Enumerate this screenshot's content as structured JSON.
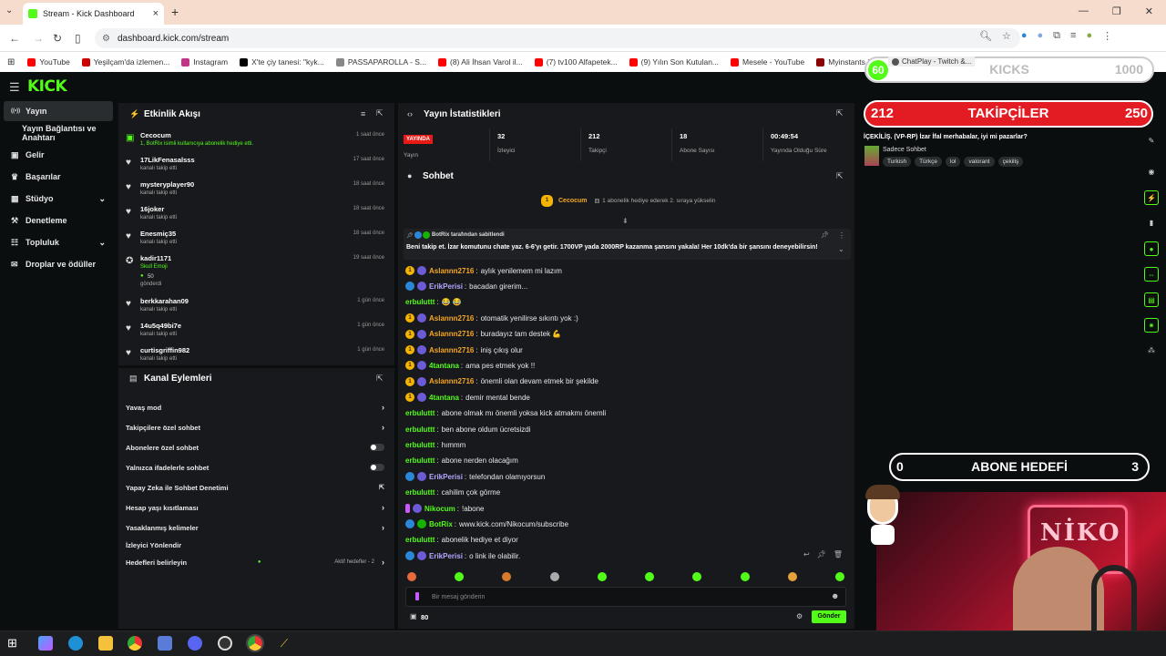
{
  "browser": {
    "tab_title": "Stream - Kick Dashboard",
    "url": "dashboard.kick.com/stream",
    "bookmarks": [
      {
        "label": "YouTube",
        "color": "#ff0000"
      },
      {
        "label": "Yeşilçam'da izlemen...",
        "color": "#cc0000"
      },
      {
        "label": "Instagram",
        "color": "#c13584"
      },
      {
        "label": "X'te çiy tanesi: \"kyk...",
        "color": "#000000"
      },
      {
        "label": "PASSAPAROLLA - S...",
        "color": "#888888"
      },
      {
        "label": "(8) Ali İhsan Varol il...",
        "color": "#ff0000"
      },
      {
        "label": "(7) tv100 Alfapetek...",
        "color": "#ff0000"
      },
      {
        "label": "(9) Yılın Son Kutulan...",
        "color": "#ff0000"
      },
      {
        "label": "Mesele - YouTube",
        "color": "#ff0000"
      },
      {
        "label": "Myinstants | The la...",
        "color": "#8b0000"
      },
      {
        "label": "ChatPlay - Twitch &...",
        "color": "#555555"
      }
    ]
  },
  "kick": {
    "logo": "KICK",
    "brand_color": "#53fc18",
    "sidebar": [
      {
        "label": "Yayın",
        "icon": "broadcast-icon",
        "active": true
      },
      {
        "label": "Yayın Bağlantısı ve Anahtarı",
        "icon": "",
        "active": false
      },
      {
        "label": "Gelir",
        "icon": "wallet-icon",
        "active": false
      },
      {
        "label": "Başarılar",
        "icon": "trophy-icon",
        "active": false
      },
      {
        "label": "Stüdyo",
        "icon": "studio-icon",
        "active": false,
        "chevron": true
      },
      {
        "label": "Denetleme",
        "icon": "hammer-icon",
        "active": false
      },
      {
        "label": "Topluluk",
        "icon": "community-icon",
        "active": false,
        "chevron": true
      },
      {
        "label": "Droplar ve ödüller",
        "icon": "gift-icon",
        "active": false
      }
    ],
    "activity": {
      "title": "Etkinlik Akışı",
      "items": [
        {
          "name": "Cecocum",
          "sub": "1, BotRix isimli kullanıcıya abonelik hediye etti.",
          "time": "1 saat önce",
          "type": "gift"
        },
        {
          "name": "17LikFenasalsss",
          "sub": "kanalı takip etti",
          "time": "17 saat önce",
          "type": "follow"
        },
        {
          "name": "mysteryplayer90",
          "sub": "kanalı takip etti",
          "time": "18 saat önce",
          "type": "follow"
        },
        {
          "name": "16joker",
          "sub": "kanalı takip etti",
          "time": "18 saat önce",
          "type": "follow"
        },
        {
          "name": "Enesmiç35",
          "sub": "kanalı takip etti",
          "time": "18 saat önce",
          "type": "follow"
        },
        {
          "name": "kadir1171",
          "sub": "Skull Emoji",
          "sub2": "50",
          "sub3": "gönderdi",
          "time": "19 saat önce",
          "type": "kicks"
        },
        {
          "name": "berkkarahan09",
          "sub": "kanalı takip etti",
          "time": "1 gün önce",
          "type": "follow"
        },
        {
          "name": "14u5q49bi7e",
          "sub": "kanalı takip etti",
          "time": "1 gün önce",
          "type": "follow"
        },
        {
          "name": "curtisgriffin982",
          "sub": "kanalı takip etti",
          "time": "1 gün önce",
          "type": "follow"
        }
      ]
    },
    "channel_actions": {
      "title": "Kanal Eylemleri",
      "items": [
        {
          "label": "Yavaş mod",
          "control": "chevron"
        },
        {
          "label": "Takipçilere özel sohbet",
          "control": "chevron"
        },
        {
          "label": "Abonelere özel sohbet",
          "control": "toggle"
        },
        {
          "label": "Yalnızca ifadelerle sohbet",
          "control": "toggle"
        },
        {
          "label": "Yapay Zeka ile Sohbet Denetimi",
          "control": "external"
        },
        {
          "label": "Hesap yaşı kısıtlaması",
          "control": "chevron"
        },
        {
          "label": "Yasaklanmış kelimeler",
          "control": "chevron"
        },
        {
          "label": "İzleyici Yönlendir",
          "control": "none"
        },
        {
          "label": "Hedefleri belirleyin",
          "control": "chevron",
          "note": "Aktif hedefler - 2"
        }
      ]
    },
    "stats": {
      "title": "Yayın İstatistikleri",
      "live_badge": "YAYINDA",
      "live_label": "Yayın",
      "items": [
        {
          "value": "32",
          "label": "İzleyici"
        },
        {
          "value": "212",
          "label": "Takipçi"
        },
        {
          "value": "18",
          "label": "Abone Sayısı"
        },
        {
          "value": "00:49:54",
          "label": "Yayında Olduğu Süre"
        }
      ]
    },
    "chat": {
      "title": "Sohbet",
      "gift_banner": {
        "name": "Cecocum",
        "count": "1",
        "text": "1 abonelik hediye ederek 2. sıraya yükselin"
      },
      "pinned_by": "BotRix tarafından sabitlendi",
      "pinned_text": "Beni takip et. İzar komutunu chate yaz. 6-6'yı getir. 1700VP yada 2000RP kazanma şansını yakala! Her 10dk'da bir şansını deneyebilirsin!",
      "messages": [
        {
          "user": "Aslannn2716",
          "color": "#f5a623",
          "badges": [
            "gold",
            "purp"
          ],
          "text": "aylık yenilemem mi lazım"
        },
        {
          "user": "ErikPerisi",
          "color": "#b2a9ff",
          "badges": [
            "blue",
            "purp"
          ],
          "text": "bacadan girerim..."
        },
        {
          "user": "erbuluttt",
          "color": "#53fc18",
          "badges": [],
          "text": "😂 😂"
        },
        {
          "user": "Aslannn2716",
          "color": "#f5a623",
          "badges": [
            "gold",
            "purp"
          ],
          "text": "otomatik yenilirse sıkıntı yok :)"
        },
        {
          "user": "Aslannn2716",
          "color": "#f5a623",
          "badges": [
            "gold",
            "purp"
          ],
          "text": "buradayız tam destek 💪"
        },
        {
          "user": "Aslannn2716",
          "color": "#f5a623",
          "badges": [
            "gold",
            "purp"
          ],
          "text": "iniş çıkış olur"
        },
        {
          "user": "4tantana",
          "color": "#53fc18",
          "badges": [
            "gold",
            "purp"
          ],
          "text": "ama pes etmek yok !!"
        },
        {
          "user": "Aslannn2716",
          "color": "#f5a623",
          "badges": [
            "gold",
            "purp"
          ],
          "text": "önemli olan devam etmek bir şekilde"
        },
        {
          "user": "4tantana",
          "color": "#53fc18",
          "badges": [
            "gold",
            "purp"
          ],
          "text": "demir mental bende"
        },
        {
          "user": "erbuluttt",
          "color": "#53fc18",
          "badges": [],
          "text": "abone olmak mı önemli yoksa kick atmakmı önemli"
        },
        {
          "user": "erbuluttt",
          "color": "#53fc18",
          "badges": [],
          "text": "ben abone oldum ücretsizdi"
        },
        {
          "user": "erbuluttt",
          "color": "#53fc18",
          "badges": [],
          "text": "hımmm"
        },
        {
          "user": "erbuluttt",
          "color": "#53fc18",
          "badges": [],
          "text": "abone nerden olacağım"
        },
        {
          "user": "ErikPerisi",
          "color": "#b2a9ff",
          "badges": [
            "blue",
            "purp"
          ],
          "text": "telefondan olamıyorsun"
        },
        {
          "user": "erbuluttt",
          "color": "#53fc18",
          "badges": [],
          "text": "cahilim çok görme"
        },
        {
          "user": "Nikocum",
          "color": "#53fc18",
          "badges": [
            "mic",
            "purp"
          ],
          "text": "!abone"
        },
        {
          "user": "BotRix",
          "color": "#53fc18",
          "badges": [
            "blue",
            "green"
          ],
          "text": "www.kick.com/Nikocum/subscribe"
        },
        {
          "user": "erbuluttt",
          "color": "#53fc18",
          "badges": [],
          "text": "abonelik hediye et diyor"
        },
        {
          "user": "ErikPerisi",
          "color": "#b2a9ff",
          "badges": [
            "blue",
            "purp"
          ],
          "text": "o link ile olabilir."
        }
      ],
      "input_placeholder": "Bir mesaj gönderin",
      "kicks_balance": "80",
      "send_label": "Gönder"
    }
  },
  "overlay": {
    "kicks": {
      "left": "60",
      "title": "KICKS",
      "right": "1000"
    },
    "followers": {
      "left": "212",
      "title": "TAKİPÇİLER",
      "right": "250"
    },
    "stream_title": "İÇEKİLİŞ. (VP-RP) İzar İfal merhabalar, iyi mi pazarlar?",
    "category": "Sadece Sohbet",
    "tags": [
      "Turkish",
      "Türkçe",
      "lol",
      "valorant",
      "çekiliş"
    ],
    "subgoal": {
      "left": "0",
      "title": "ABONE HEDEFİ",
      "right": "3"
    },
    "cam_text": "NİKO"
  }
}
